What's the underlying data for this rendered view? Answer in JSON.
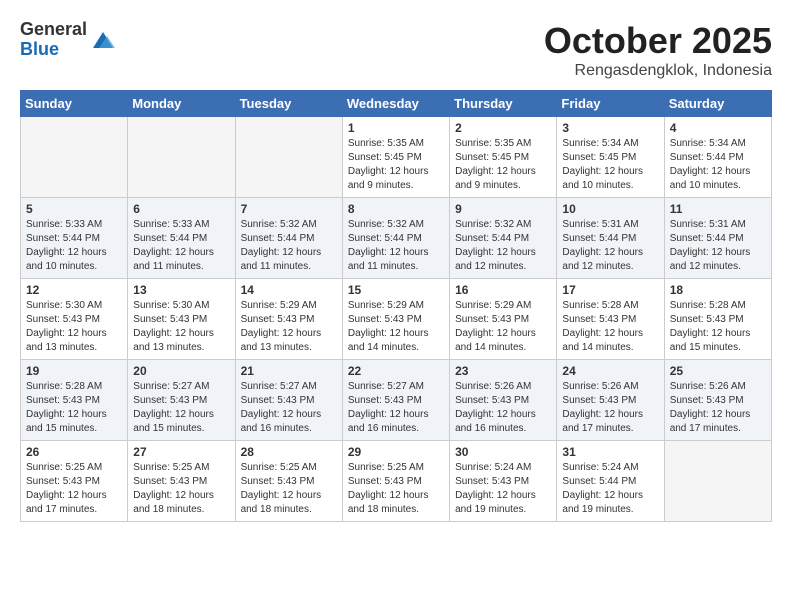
{
  "header": {
    "logo_general": "General",
    "logo_blue": "Blue",
    "month": "October 2025",
    "location": "Rengasdengklok, Indonesia"
  },
  "weekdays": [
    "Sunday",
    "Monday",
    "Tuesday",
    "Wednesday",
    "Thursday",
    "Friday",
    "Saturday"
  ],
  "weeks": [
    [
      {
        "day": "",
        "content": ""
      },
      {
        "day": "",
        "content": ""
      },
      {
        "day": "",
        "content": ""
      },
      {
        "day": "1",
        "content": "Sunrise: 5:35 AM\nSunset: 5:45 PM\nDaylight: 12 hours and 9 minutes."
      },
      {
        "day": "2",
        "content": "Sunrise: 5:35 AM\nSunset: 5:45 PM\nDaylight: 12 hours and 9 minutes."
      },
      {
        "day": "3",
        "content": "Sunrise: 5:34 AM\nSunset: 5:45 PM\nDaylight: 12 hours and 10 minutes."
      },
      {
        "day": "4",
        "content": "Sunrise: 5:34 AM\nSunset: 5:44 PM\nDaylight: 12 hours and 10 minutes."
      }
    ],
    [
      {
        "day": "5",
        "content": "Sunrise: 5:33 AM\nSunset: 5:44 PM\nDaylight: 12 hours and 10 minutes."
      },
      {
        "day": "6",
        "content": "Sunrise: 5:33 AM\nSunset: 5:44 PM\nDaylight: 12 hours and 11 minutes."
      },
      {
        "day": "7",
        "content": "Sunrise: 5:32 AM\nSunset: 5:44 PM\nDaylight: 12 hours and 11 minutes."
      },
      {
        "day": "8",
        "content": "Sunrise: 5:32 AM\nSunset: 5:44 PM\nDaylight: 12 hours and 11 minutes."
      },
      {
        "day": "9",
        "content": "Sunrise: 5:32 AM\nSunset: 5:44 PM\nDaylight: 12 hours and 12 minutes."
      },
      {
        "day": "10",
        "content": "Sunrise: 5:31 AM\nSunset: 5:44 PM\nDaylight: 12 hours and 12 minutes."
      },
      {
        "day": "11",
        "content": "Sunrise: 5:31 AM\nSunset: 5:44 PM\nDaylight: 12 hours and 12 minutes."
      }
    ],
    [
      {
        "day": "12",
        "content": "Sunrise: 5:30 AM\nSunset: 5:43 PM\nDaylight: 12 hours and 13 minutes."
      },
      {
        "day": "13",
        "content": "Sunrise: 5:30 AM\nSunset: 5:43 PM\nDaylight: 12 hours and 13 minutes."
      },
      {
        "day": "14",
        "content": "Sunrise: 5:29 AM\nSunset: 5:43 PM\nDaylight: 12 hours and 13 minutes."
      },
      {
        "day": "15",
        "content": "Sunrise: 5:29 AM\nSunset: 5:43 PM\nDaylight: 12 hours and 14 minutes."
      },
      {
        "day": "16",
        "content": "Sunrise: 5:29 AM\nSunset: 5:43 PM\nDaylight: 12 hours and 14 minutes."
      },
      {
        "day": "17",
        "content": "Sunrise: 5:28 AM\nSunset: 5:43 PM\nDaylight: 12 hours and 14 minutes."
      },
      {
        "day": "18",
        "content": "Sunrise: 5:28 AM\nSunset: 5:43 PM\nDaylight: 12 hours and 15 minutes."
      }
    ],
    [
      {
        "day": "19",
        "content": "Sunrise: 5:28 AM\nSunset: 5:43 PM\nDaylight: 12 hours and 15 minutes."
      },
      {
        "day": "20",
        "content": "Sunrise: 5:27 AM\nSunset: 5:43 PM\nDaylight: 12 hours and 15 minutes."
      },
      {
        "day": "21",
        "content": "Sunrise: 5:27 AM\nSunset: 5:43 PM\nDaylight: 12 hours and 16 minutes."
      },
      {
        "day": "22",
        "content": "Sunrise: 5:27 AM\nSunset: 5:43 PM\nDaylight: 12 hours and 16 minutes."
      },
      {
        "day": "23",
        "content": "Sunrise: 5:26 AM\nSunset: 5:43 PM\nDaylight: 12 hours and 16 minutes."
      },
      {
        "day": "24",
        "content": "Sunrise: 5:26 AM\nSunset: 5:43 PM\nDaylight: 12 hours and 17 minutes."
      },
      {
        "day": "25",
        "content": "Sunrise: 5:26 AM\nSunset: 5:43 PM\nDaylight: 12 hours and 17 minutes."
      }
    ],
    [
      {
        "day": "26",
        "content": "Sunrise: 5:25 AM\nSunset: 5:43 PM\nDaylight: 12 hours and 17 minutes."
      },
      {
        "day": "27",
        "content": "Sunrise: 5:25 AM\nSunset: 5:43 PM\nDaylight: 12 hours and 18 minutes."
      },
      {
        "day": "28",
        "content": "Sunrise: 5:25 AM\nSunset: 5:43 PM\nDaylight: 12 hours and 18 minutes."
      },
      {
        "day": "29",
        "content": "Sunrise: 5:25 AM\nSunset: 5:43 PM\nDaylight: 12 hours and 18 minutes."
      },
      {
        "day": "30",
        "content": "Sunrise: 5:24 AM\nSunset: 5:43 PM\nDaylight: 12 hours and 19 minutes."
      },
      {
        "day": "31",
        "content": "Sunrise: 5:24 AM\nSunset: 5:44 PM\nDaylight: 12 hours and 19 minutes."
      },
      {
        "day": "",
        "content": ""
      }
    ]
  ]
}
